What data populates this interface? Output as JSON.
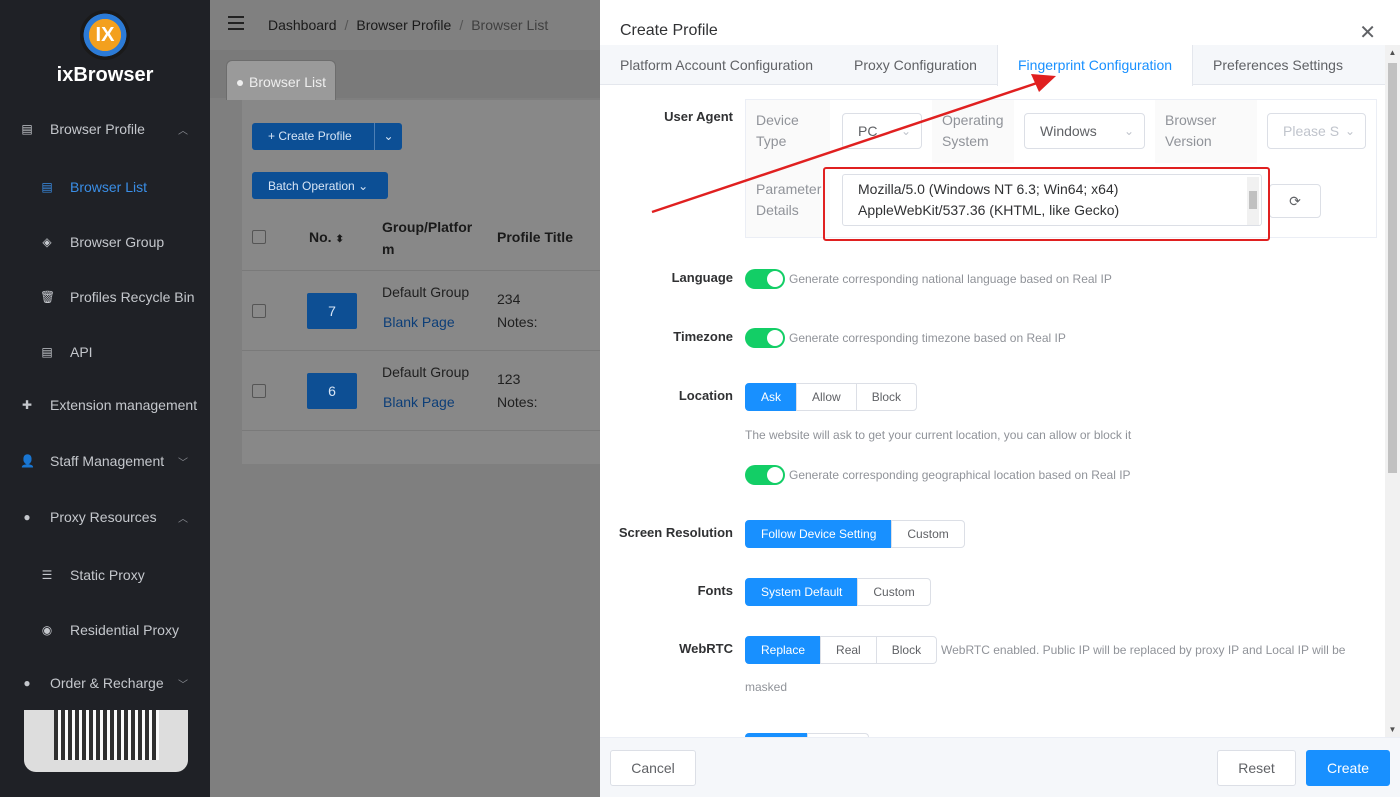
{
  "sidebar": {
    "app_name": "ixBrowser",
    "logo_text": "IX",
    "items": [
      {
        "label": "Browser Profile",
        "icon": "calendar-icon",
        "expanded": true
      },
      {
        "label": "Browser List",
        "icon": "calendar-icon",
        "active": true
      },
      {
        "label": "Browser Group",
        "icon": "layers-icon"
      },
      {
        "label": "Profiles Recycle Bin",
        "icon": "trash-icon"
      },
      {
        "label": "API",
        "icon": "calendar-icon"
      },
      {
        "label": "Extension management",
        "icon": "puzzle-icon"
      },
      {
        "label": "Staff Management",
        "icon": "user-icon"
      },
      {
        "label": "Proxy Resources",
        "icon": "globe-icon",
        "expanded": true
      },
      {
        "label": "Static Proxy",
        "icon": "list-icon"
      },
      {
        "label": "Residential Proxy",
        "icon": "dashboard-icon"
      },
      {
        "label": "Order & Recharge",
        "icon": "coin-icon"
      }
    ]
  },
  "topbar": {
    "breadcrumb": [
      "Dashboard",
      "Browser Profile",
      "Browser List"
    ],
    "tab": "Browser List"
  },
  "list": {
    "create_button": "+ Create Profile",
    "batch_button": "Batch Operation",
    "columns": {
      "no": "No.",
      "group": "Group/Platfor\nm",
      "title": "Profile Title"
    },
    "rows": [
      {
        "no": "7",
        "group": "Default Group",
        "platform": "Blank Page",
        "title": "234",
        "notes": "Notes:"
      },
      {
        "no": "6",
        "group": "Default Group",
        "platform": "Blank Page",
        "title": "123",
        "notes": "Notes:"
      }
    ]
  },
  "drawer": {
    "title": "Create Profile",
    "tabs": [
      "Platform Account Configuration",
      "Proxy Configuration",
      "Fingerprint Configuration",
      "Preferences Settings"
    ],
    "active_tab": "Fingerprint Configuration",
    "user_agent": {
      "label": "User Agent",
      "device_type_label": "Device Type",
      "device_type_value": "PC",
      "os_label": "Operating System",
      "os_value": "Windows",
      "browser_version_label": "Browser Version",
      "browser_version_placeholder": "Please S",
      "param_label": "Parameter Details",
      "ua_line1": "Mozilla/5.0 (Windows NT 6.3; Win64; x64)",
      "ua_line2": "AppleWebKit/537.36 (KHTML, like Gecko)"
    },
    "language": {
      "label": "Language",
      "hint": "Generate corresponding national language based on Real IP",
      "enabled": true
    },
    "timezone": {
      "label": "Timezone",
      "hint": "Generate corresponding timezone based on Real IP",
      "enabled": true
    },
    "location": {
      "label": "Location",
      "options": [
        "Ask",
        "Allow",
        "Block"
      ],
      "selected": "Ask",
      "note": "The website will ask to get your current location, you can allow or block it",
      "geo_hint": "Generate corresponding geographical location based on Real IP",
      "geo_enabled": true
    },
    "screen": {
      "label": "Screen Resolution",
      "options": [
        "Follow Device Setting",
        "Custom"
      ],
      "selected": "Follow Device Setting"
    },
    "fonts": {
      "label": "Fonts",
      "options": [
        "System Default",
        "Custom"
      ],
      "selected": "System Default"
    },
    "webrtc": {
      "label": "WebRTC",
      "options": [
        "Replace",
        "Real",
        "Block"
      ],
      "selected": "Replace",
      "note_line1": "WebRTC enabled. Public IP will be replaced by proxy IP and Local IP will be",
      "note_line2": "masked"
    },
    "footer": {
      "cancel": "Cancel",
      "reset": "Reset",
      "create": "Create"
    }
  },
  "colors": {
    "primary": "#1890ff",
    "toggle_on": "#13ce66",
    "annotation_red": "#e02020",
    "sidebar_bg": "#1f2126"
  }
}
